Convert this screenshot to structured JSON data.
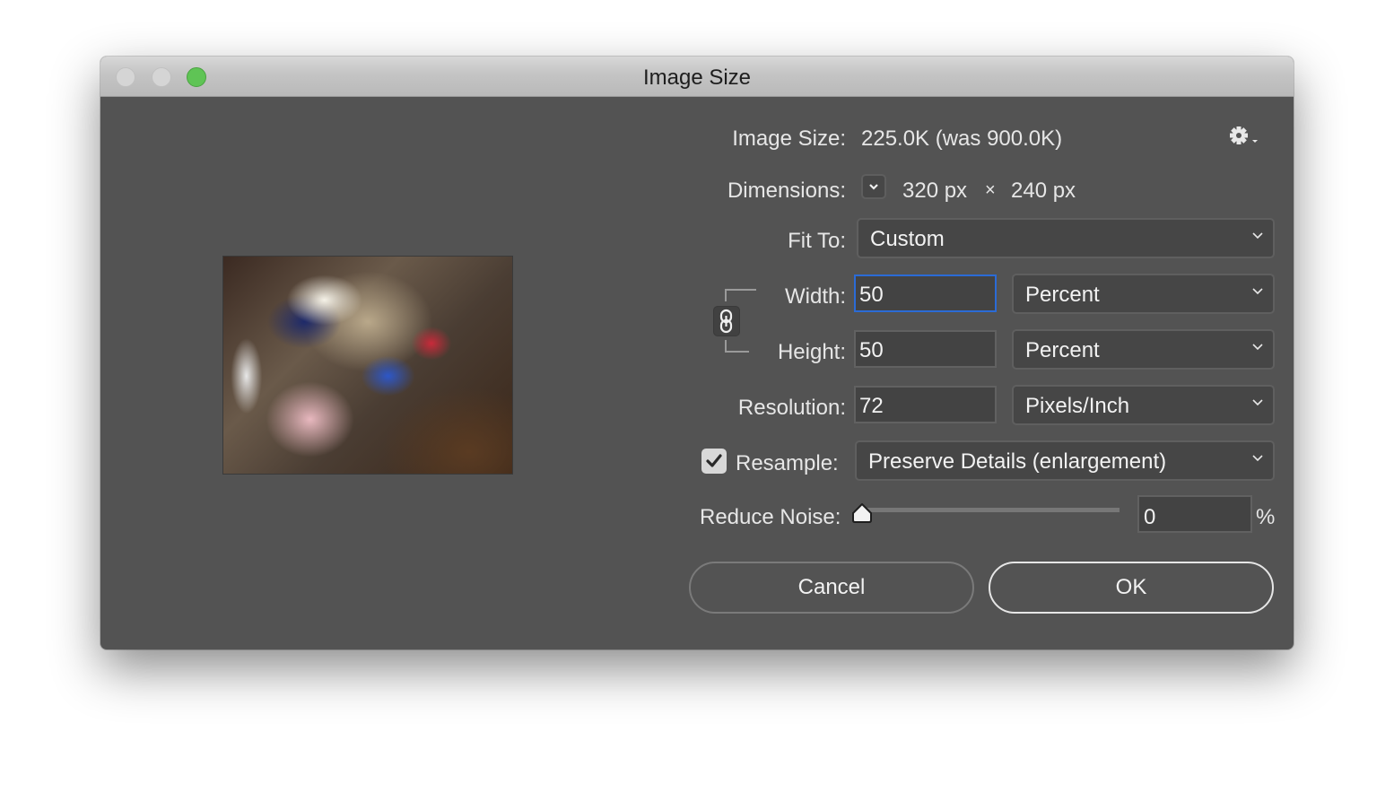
{
  "window": {
    "title": "Image Size",
    "traffic_lights": [
      "close",
      "minimize",
      "zoom"
    ],
    "accent_color": "#2b6bd6"
  },
  "preview": {
    "alt": "image-preview-thumbnail"
  },
  "image_size": {
    "label": "Image Size:",
    "value": "225.0K (was 900.0K)"
  },
  "settings": {
    "icon": "gear-icon"
  },
  "dimensions": {
    "label": "Dimensions:",
    "width": "320 px",
    "times": "×",
    "height": "240 px"
  },
  "fit_to": {
    "label": "Fit To:",
    "selected": "Custom"
  },
  "width": {
    "label": "Width:",
    "value": "50",
    "unit": "Percent"
  },
  "height": {
    "label": "Height:",
    "value": "50",
    "unit": "Percent"
  },
  "constrain_proportions": {
    "icon": "link-icon",
    "linked": true
  },
  "resolution": {
    "label": "Resolution:",
    "value": "72",
    "unit": "Pixels/Inch"
  },
  "resample": {
    "label": "Resample:",
    "checked": true,
    "selected": "Preserve Details (enlargement)"
  },
  "reduce_noise": {
    "label": "Reduce Noise:",
    "value": "0",
    "percent_sign": "%",
    "slider_fraction": 0
  },
  "buttons": {
    "cancel": "Cancel",
    "ok": "OK"
  }
}
